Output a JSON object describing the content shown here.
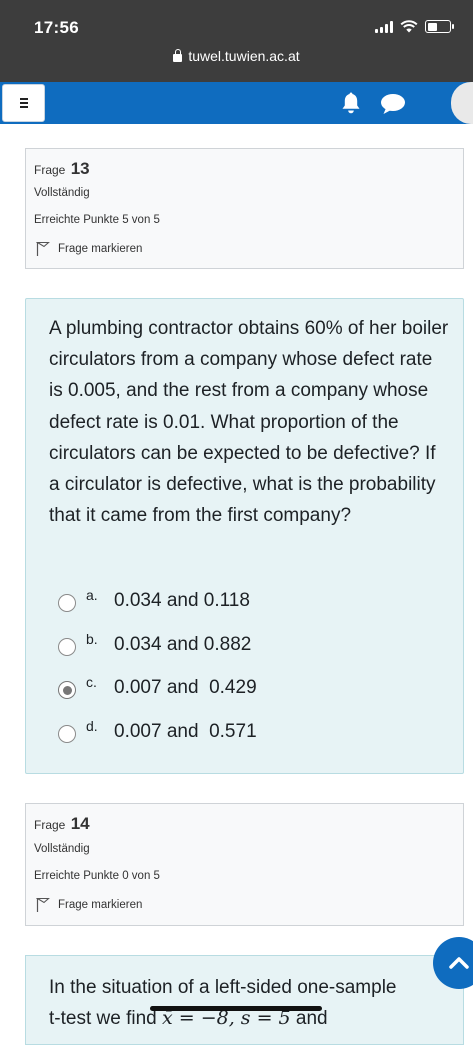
{
  "status_bar": {
    "time": "17:56",
    "url": "tuwel.tuwien.ac.at"
  },
  "navbar": {
    "menu_icon": "hamburger-icon",
    "notification_icon": "bell-icon",
    "messages_icon": "chat-icon",
    "brand_color": "#0f6cbf"
  },
  "question13": {
    "frage_label": "Frage",
    "number": "13",
    "state": "Vollständig",
    "grade": "Erreichte Punkte 5 von 5",
    "flag_label": "Frage markieren",
    "text": "A plumbing contractor obtains 60% of her boiler circulators from a company whose defect rate is 0.005, and the rest from a company whose defect rate is 0.01. What proportion of the circulators can be expected to be defective? If a circulator is defective, what is the probability that it came from the first company?",
    "answers": [
      {
        "letter": "a.",
        "text": "0.034 and 0.118",
        "selected": false
      },
      {
        "letter": "b.",
        "text": "0.034 and 0.882",
        "selected": false
      },
      {
        "letter": "c.",
        "text": "0.007 and  0.429",
        "selected": true
      },
      {
        "letter": "d.",
        "text": "0.007 and  0.571",
        "selected": false
      }
    ]
  },
  "question14": {
    "frage_label": "Frage",
    "number": "14",
    "state": "Vollständig",
    "grade": "Erreichte Punkte 0 von 5",
    "flag_label": "Frage markieren",
    "text_line1": "In the situation of a left-sided one-sample",
    "text_line2_start": "t-test we find",
    "text_line2_math": "x̄ = −8, s = 5",
    "text_line2_end": "and"
  },
  "scroll_top_icon": "chevron-up-icon"
}
